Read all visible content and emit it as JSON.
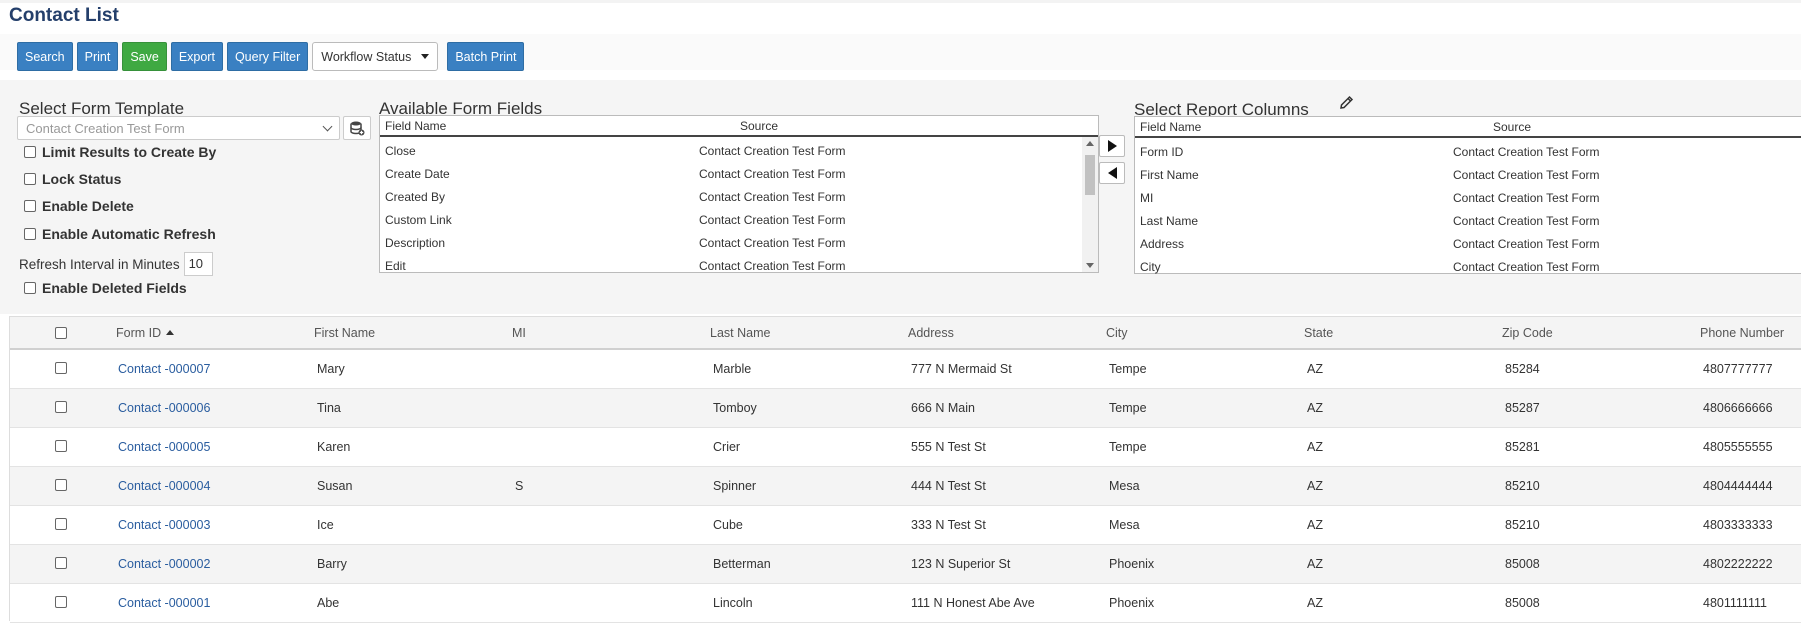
{
  "page": {
    "title": "Contact List"
  },
  "toolbar": {
    "search": "Search",
    "print": "Print",
    "save": "Save",
    "export": "Export",
    "query_filter": "Query Filter",
    "workflow_status": "Workflow Status",
    "batch_print": "Batch Print"
  },
  "template": {
    "heading": "Select Form Template",
    "selected": "Contact Creation Test Form",
    "options": {
      "limit_results": "Limit Results to Create By",
      "lock_status": "Lock Status",
      "enable_delete": "Enable Delete",
      "enable_auto_refresh": "Enable Automatic Refresh",
      "refresh_interval_label": "Refresh Interval in Minutes",
      "refresh_interval_value": "10",
      "enable_deleted_fields": "Enable Deleted Fields"
    }
  },
  "available": {
    "heading": "Available Form Fields",
    "col_field": "Field Name",
    "col_source": "Source",
    "rows": [
      {
        "field": "Close",
        "source": "Contact Creation Test Form"
      },
      {
        "field": "Create Date",
        "source": "Contact Creation Test Form"
      },
      {
        "field": "Created By",
        "source": "Contact Creation Test Form"
      },
      {
        "field": "Custom Link",
        "source": "Contact Creation Test Form"
      },
      {
        "field": "Description",
        "source": "Contact Creation Test Form"
      },
      {
        "field": "Edit",
        "source": "Contact Creation Test Form"
      }
    ]
  },
  "report": {
    "heading": "Select Report Columns",
    "col_field": "Field Name",
    "col_source": "Source",
    "rows": [
      {
        "field": "Form ID",
        "source": "Contact Creation Test Form"
      },
      {
        "field": "First Name",
        "source": "Contact Creation Test Form"
      },
      {
        "field": "MI",
        "source": "Contact Creation Test Form"
      },
      {
        "field": "Last Name",
        "source": "Contact Creation Test Form"
      },
      {
        "field": "Address",
        "source": "Contact Creation Test Form"
      },
      {
        "field": "City",
        "source": "Contact Creation Test Form"
      }
    ]
  },
  "grid": {
    "columns": {
      "form_id": "Form ID",
      "first_name": "First Name",
      "mi": "MI",
      "last_name": "Last Name",
      "address": "Address",
      "city": "City",
      "state": "State",
      "zip": "Zip Code",
      "phone": "Phone Number"
    },
    "rows": [
      {
        "form_id": "Contact -000007",
        "first_name": "Mary",
        "mi": "",
        "last_name": "Marble",
        "address": "777 N Mermaid St",
        "city": "Tempe",
        "state": "AZ",
        "zip": "85284",
        "phone": "4807777777"
      },
      {
        "form_id": "Contact -000006",
        "first_name": "Tina",
        "mi": "",
        "last_name": "Tomboy",
        "address": "666 N Main",
        "city": "Tempe",
        "state": "AZ",
        "zip": "85287",
        "phone": "4806666666"
      },
      {
        "form_id": "Contact -000005",
        "first_name": "Karen",
        "mi": "",
        "last_name": "Crier",
        "address": "555 N Test St",
        "city": "Tempe",
        "state": "AZ",
        "zip": "85281",
        "phone": "4805555555"
      },
      {
        "form_id": "Contact -000004",
        "first_name": "Susan",
        "mi": "S",
        "last_name": "Spinner",
        "address": "444 N Test St",
        "city": "Mesa",
        "state": "AZ",
        "zip": "85210",
        "phone": "4804444444"
      },
      {
        "form_id": "Contact -000003",
        "first_name": "Ice",
        "mi": "",
        "last_name": "Cube",
        "address": "333 N Test St",
        "city": "Mesa",
        "state": "AZ",
        "zip": "85210",
        "phone": "4803333333"
      },
      {
        "form_id": "Contact -000002",
        "first_name": "Barry",
        "mi": "",
        "last_name": "Betterman",
        "address": "123 N Superior St",
        "city": "Phoenix",
        "state": "AZ",
        "zip": "85008",
        "phone": "4802222222"
      },
      {
        "form_id": "Contact -000001",
        "first_name": "Abe",
        "mi": "",
        "last_name": "Lincoln",
        "address": "111 N Honest Abe Ave",
        "city": "Phoenix",
        "state": "AZ",
        "zip": "85008",
        "phone": "4801111111"
      }
    ]
  }
}
